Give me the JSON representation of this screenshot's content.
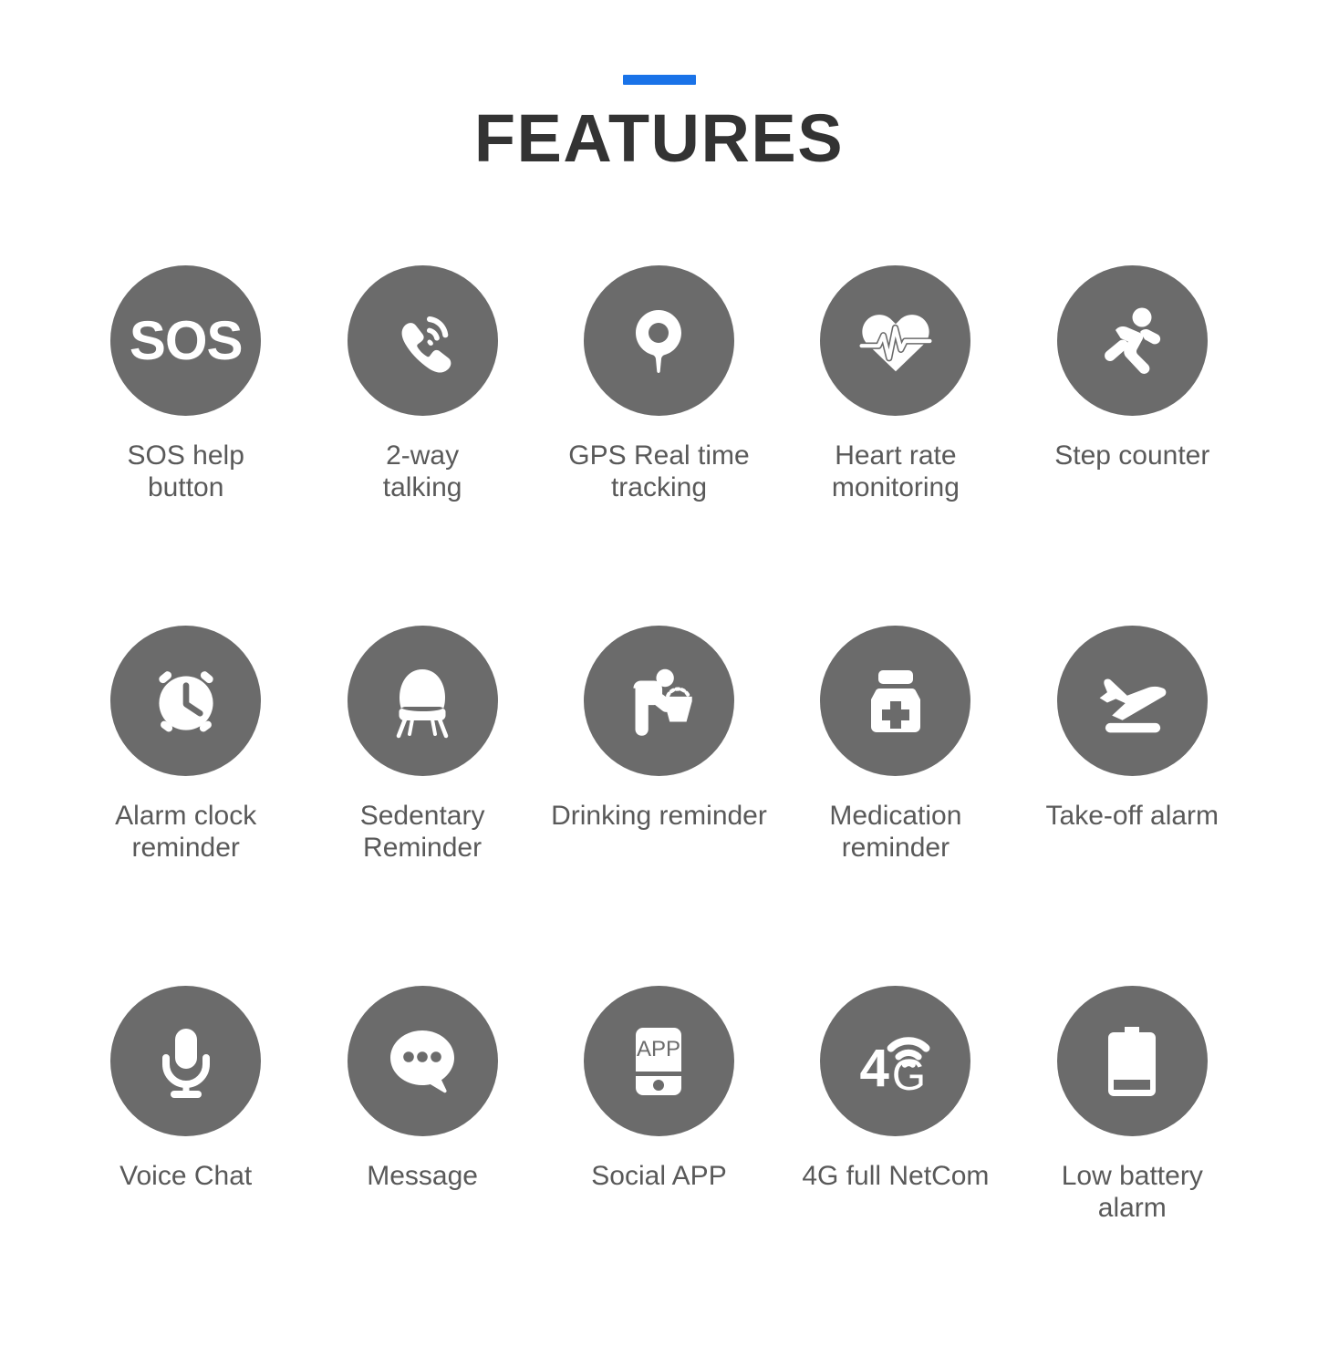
{
  "header": {
    "accent_color": "#1a73e8",
    "title": "FEATURES"
  },
  "theme": {
    "icon_circle_color": "#6b6b6b",
    "icon_glyph_color": "#ffffff",
    "label_color": "#595959",
    "title_color": "#333333",
    "background": "#ffffff"
  },
  "grid": {
    "columns": 5,
    "rows": 3
  },
  "features": [
    {
      "id": "sos-help-button",
      "icon": "sos-icon",
      "icon_text": "SOS",
      "label": "SOS help\nbutton"
    },
    {
      "id": "two-way-talking",
      "icon": "phone-call-icon",
      "icon_text": "",
      "label": "2-way\ntalking"
    },
    {
      "id": "gps-real-time",
      "icon": "location-pin-icon",
      "icon_text": "",
      "label": "GPS Real time\ntracking"
    },
    {
      "id": "heart-rate",
      "icon": "heart-pulse-icon",
      "icon_text": "",
      "label": "Heart rate\nmonitoring"
    },
    {
      "id": "step-counter",
      "icon": "running-person-icon",
      "icon_text": "",
      "label": "Step counter"
    },
    {
      "id": "alarm-clock",
      "icon": "alarm-clock-icon",
      "icon_text": "",
      "label": "Alarm clock\nreminder"
    },
    {
      "id": "sedentary-reminder",
      "icon": "chair-icon",
      "icon_text": "",
      "label": "Sedentary\nReminder"
    },
    {
      "id": "drinking-reminder",
      "icon": "water-fountain-icon",
      "icon_text": "",
      "label": "Drinking reminder"
    },
    {
      "id": "medication-reminder",
      "icon": "pill-bottle-icon",
      "icon_text": "",
      "label": "Medication\nreminder"
    },
    {
      "id": "take-off-alarm",
      "icon": "airplane-takeoff-icon",
      "icon_text": "",
      "label": "Take-off alarm"
    },
    {
      "id": "voice-chat",
      "icon": "microphone-icon",
      "icon_text": "",
      "label": "Voice Chat"
    },
    {
      "id": "message",
      "icon": "speech-bubble-icon",
      "icon_text": "",
      "label": "Message"
    },
    {
      "id": "social-app",
      "icon": "smartphone-app-icon",
      "icon_text": "APP",
      "label": "Social APP"
    },
    {
      "id": "4g-full-netcom",
      "icon": "four-g-signal-icon",
      "icon_text": "4G",
      "label": "4G full NetCom"
    },
    {
      "id": "low-battery-alarm",
      "icon": "battery-low-icon",
      "icon_text": "",
      "label": "Low battery\nalarm"
    }
  ]
}
